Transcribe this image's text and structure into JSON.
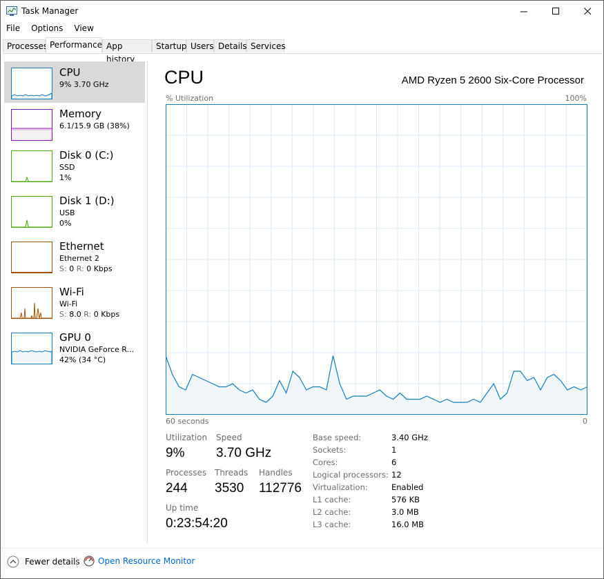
{
  "window": {
    "title": "Task Manager",
    "controls": {
      "minimize": "–",
      "maximize": "☐",
      "close": "✕"
    }
  },
  "menu": [
    "File",
    "Options",
    "View"
  ],
  "tabs": [
    "Processes",
    "Performance",
    "App history",
    "Startup",
    "Users",
    "Details",
    "Services"
  ],
  "active_tab": "Performance",
  "sidebar": [
    {
      "title": "CPU",
      "lines": [
        "9% 3.70 GHz"
      ],
      "color": "#117dbb",
      "fill": "#f1f6fa"
    },
    {
      "title": "Memory",
      "lines": [
        "6.1/15.9 GB (38%)"
      ],
      "color": "#8b12ae",
      "fill": "#f4f2f4"
    },
    {
      "title": "Disk 0 (C:)",
      "lines": [
        "SSD",
        "1%"
      ],
      "color": "#4da60c",
      "fill": "#eff7ea"
    },
    {
      "title": "Disk 1 (D:)",
      "lines": [
        "USB",
        "0%"
      ],
      "color": "#4da60c",
      "fill": "#eff7ea"
    },
    {
      "title": "Ethernet",
      "lines": [
        "Ethernet 2"
      ],
      "net": {
        "s_label": "S:",
        "s_value": "0",
        "r_label": "R:",
        "r_value": "0 Kbps"
      },
      "color": "#a74f01",
      "fill": "#fcf3eb"
    },
    {
      "title": "Wi-Fi",
      "lines": [
        "Wi-Fi"
      ],
      "net": {
        "s_label": "S:",
        "s_value": "8.0",
        "r_label": "R:",
        "r_value": "0 Kbps"
      },
      "color": "#a74f01",
      "fill": "#fcf3eb"
    },
    {
      "title": "GPU 0",
      "lines": [
        "NVIDIA GeForce R...",
        "42% (34 °C)"
      ],
      "color": "#117dbb",
      "fill": "#f1f6fa"
    }
  ],
  "main": {
    "title": "CPU",
    "processor": "AMD Ryzen 5 2600 Six-Core Processor",
    "y_label": "% Utilization",
    "y_max_label": "100%",
    "x_label": "60 seconds",
    "x_min_label": "0"
  },
  "stats": {
    "utilization_label": "Utilization",
    "utilization": "9%",
    "speed_label": "Speed",
    "speed": "3.70 GHz",
    "processes_label": "Processes",
    "processes": "244",
    "threads_label": "Threads",
    "threads": "3530",
    "handles_label": "Handles",
    "handles": "112776",
    "uptime_label": "Up time",
    "uptime": "0:23:54:20"
  },
  "details": [
    {
      "key": "Base speed:",
      "value": "3.40 GHz"
    },
    {
      "key": "Sockets:",
      "value": "1"
    },
    {
      "key": "Cores:",
      "value": "6"
    },
    {
      "key": "Logical processors:",
      "value": "12"
    },
    {
      "key": "Virtualization:",
      "value": "Enabled"
    },
    {
      "key": "L1 cache:",
      "value": "576 KB"
    },
    {
      "key": "L2 cache:",
      "value": "3.0 MB"
    },
    {
      "key": "L3 cache:",
      "value": "16.0 MB"
    }
  ],
  "footer": {
    "fewer_details": "Fewer details",
    "resource_monitor": "Open Resource Monitor"
  },
  "chart_data": {
    "type": "line",
    "ylim": [
      0,
      100
    ],
    "xlabel": "60 seconds",
    "ylabel": "% Utilization",
    "grid": true,
    "color": "#117dbb",
    "fill": "#f1f6fa",
    "values": [
      19,
      13,
      9,
      8,
      13,
      12,
      11,
      10,
      9,
      9,
      10,
      8,
      7,
      8,
      5,
      4,
      6,
      11,
      7,
      14,
      12,
      8,
      9,
      9,
      8,
      19,
      10,
      5,
      6,
      6,
      6,
      7,
      8,
      6,
      5,
      7,
      5,
      5,
      5,
      6,
      5,
      4,
      5,
      4,
      4,
      4,
      5,
      4,
      7,
      10,
      5,
      7,
      14,
      14,
      11,
      12,
      8,
      12,
      13,
      11,
      8,
      9,
      8,
      9
    ]
  }
}
